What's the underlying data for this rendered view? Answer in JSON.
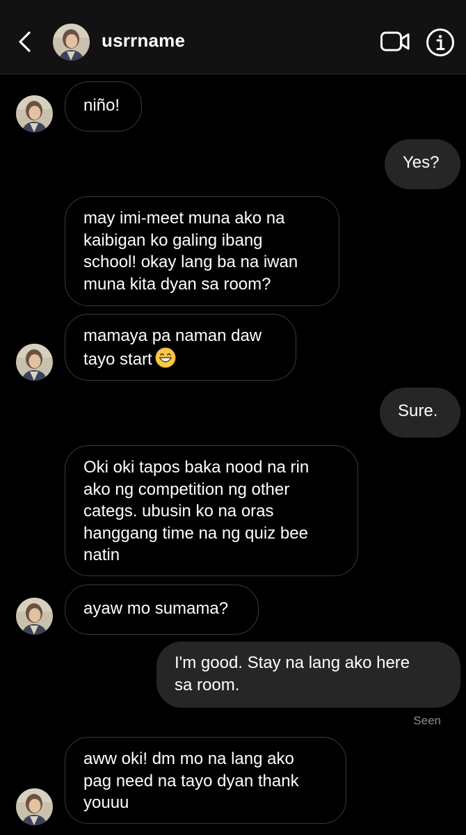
{
  "header": {
    "username": "usrrname",
    "back_icon": "chevron-left-icon",
    "video_icon": "video-camera-icon",
    "info_icon": "info-icon"
  },
  "messages": [
    {
      "from": "them",
      "lines": [
        "niño!"
      ]
    },
    {
      "from": "me",
      "lines": [
        "Yes?"
      ]
    },
    {
      "from": "them",
      "lines": [
        "may imi-meet muna ako na",
        "kaibigan ko galing ibang",
        "school! okay lang ba na iwan",
        "muna kita dyan sa room?"
      ]
    },
    {
      "from": "them",
      "lines": [
        "mamaya pa naman daw",
        "tayo start"
      ],
      "emoji": "grinning-face-emoji"
    },
    {
      "from": "me",
      "lines": [
        "Sure."
      ]
    },
    {
      "from": "them",
      "lines": [
        "Oki oki tapos baka nood na rin",
        "ako ng competition ng other",
        "categs. ubusin ko na oras",
        "hanggang time na ng quiz bee",
        "natin"
      ]
    },
    {
      "from": "them",
      "lines": [
        "ayaw mo sumama?"
      ]
    },
    {
      "from": "me",
      "lines": [
        "I'm good. Stay na lang ako here",
        "sa room."
      ]
    },
    {
      "from": "them",
      "lines": [
        "aww oki! dm mo na lang ako",
        "pag need na tayo dyan thank",
        "youuu"
      ]
    }
  ],
  "seen_label": "Seen",
  "colors": {
    "background": "#000000",
    "header_bg": "#121212",
    "outgoing_bubble": "#262626",
    "incoming_border": "#3a3a3a",
    "seen_text": "#8e8e8e"
  }
}
